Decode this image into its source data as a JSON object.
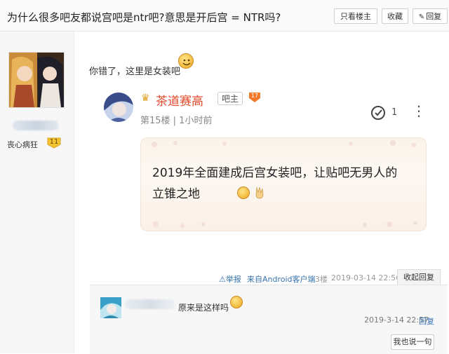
{
  "header": {
    "title": "为什么很多吧友都说宫吧是ntr吧?意思是开后宫 = NTR吗?",
    "only_host_label": "只看楼主",
    "favorite_label": "收藏",
    "reply_label": "回复"
  },
  "author": {
    "tag": "丧心病狂",
    "level": "11"
  },
  "post": {
    "text": "你错了，这里是女装吧"
  },
  "quote": {
    "name": "茶道赛高",
    "badge": "吧主",
    "level": "17",
    "meta": "第15楼 | 1小时前",
    "like_count": "1",
    "more": "⋮",
    "content": "2019年全面建成后宫女装吧，让贴吧无男人的立锥之地"
  },
  "footer": {
    "report_label": "举报",
    "source": "来自Android客户端",
    "floor": "3楼",
    "time": "2019-03-14 22:56",
    "collapse_label": "收起回复"
  },
  "sub_reply": {
    "text": "原来是这样吗",
    "time": "2019-3-14 22:57",
    "reply_label": "回复",
    "say_label": "我也说一句"
  }
}
